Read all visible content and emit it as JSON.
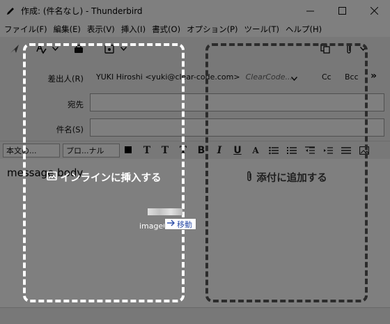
{
  "window": {
    "title": "作成: (件名なし) - Thunderbird"
  },
  "menu": [
    "ファイル(F)",
    "編集(E)",
    "表示(V)",
    "挿入(I)",
    "書式(O)",
    "オプション(P)",
    "ツール(T)",
    "ヘルプ(H)"
  ],
  "header": {
    "from_label": "差出人(R)",
    "from_identity": "YUKI Hiroshi <yuki@clear-code.com>",
    "from_alias": "ClearCode...",
    "cc_label": "Cc",
    "bcc_label": "Bcc",
    "to_label": "宛先",
    "subject_label": "件名(S)"
  },
  "format": {
    "paragraph": "本文の...",
    "font": "プロ...ナル"
  },
  "body": {
    "text": "message body"
  },
  "drop_zones": {
    "inline": {
      "label": "インラインに挿入する",
      "border_color": "#ffffff"
    },
    "attach": {
      "label": "添付に追加する",
      "border_color": "#2c2c2c"
    }
  },
  "drag": {
    "file_name": "image0",
    "action_label": "移動"
  },
  "overlay": {
    "color": "#000000",
    "opacity": 0.5
  }
}
